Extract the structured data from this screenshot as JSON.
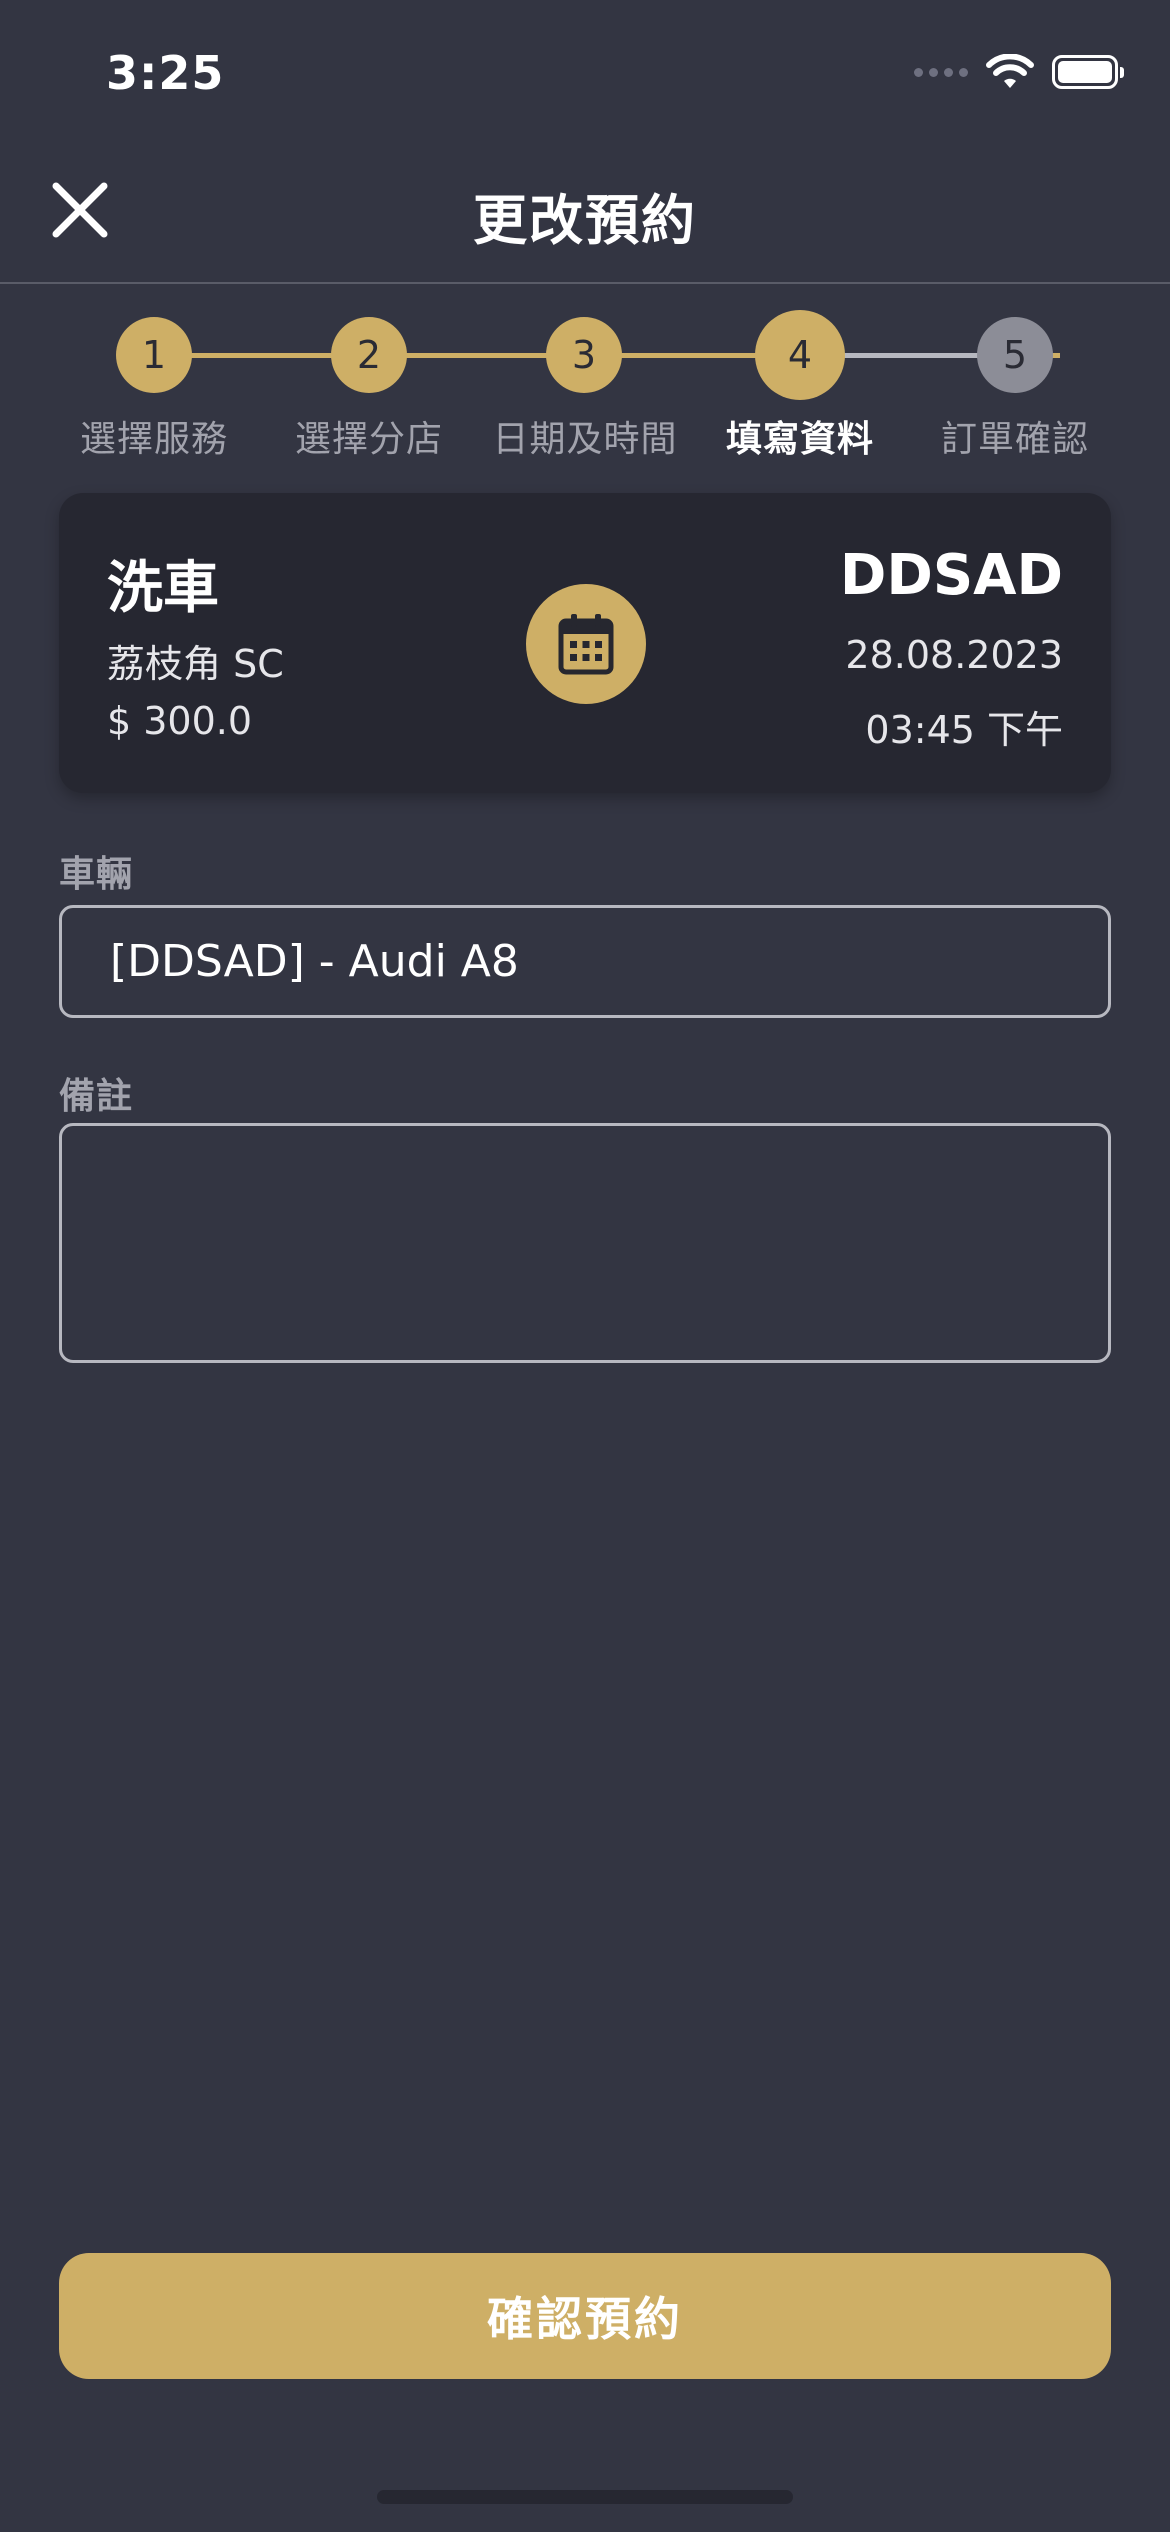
{
  "status_bar": {
    "time": "3:25"
  },
  "header": {
    "title": "更改預約"
  },
  "stepper": {
    "steps": [
      {
        "number": "1",
        "label": "選擇服務",
        "state": "done"
      },
      {
        "number": "2",
        "label": "選擇分店",
        "state": "done"
      },
      {
        "number": "3",
        "label": "日期及時間",
        "state": "done"
      },
      {
        "number": "4",
        "label": "填寫資料",
        "state": "current"
      },
      {
        "number": "5",
        "label": "訂單確認",
        "state": "pending"
      }
    ],
    "active_color": "#ceaf66",
    "pending_color": "#8c8d97"
  },
  "summary": {
    "service": "洗車",
    "shop": "荔枝角 SC",
    "price": "$ 300.0",
    "plate": "DDSAD",
    "date": "28.08.2023",
    "time": "03:45 下午",
    "icon": "calendar-icon"
  },
  "form": {
    "vehicle_label": "車輛",
    "vehicle_value": "[DDSAD] - Audi A8",
    "notes_label": "備註",
    "notes_value": ""
  },
  "actions": {
    "confirm_label": "確認預約"
  },
  "colors": {
    "background": "#333542",
    "card": "#262731",
    "accent": "#ceaf66"
  }
}
